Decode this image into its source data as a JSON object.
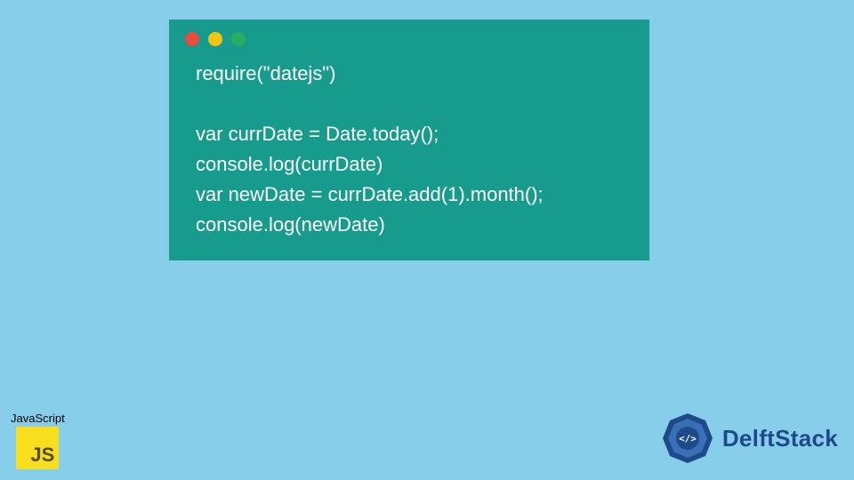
{
  "codeWindow": {
    "dots": [
      "red",
      "yellow",
      "green"
    ],
    "lines": [
      "require(\"datejs\")",
      "",
      "var currDate = Date.today();",
      "console.log(currDate)",
      "var newDate = currDate.add(1).month();",
      "console.log(newDate)"
    ]
  },
  "jsBadge": {
    "label": "JavaScript",
    "logoText": "JS"
  },
  "delft": {
    "brand": "DelftStack",
    "iconGlyph": "</>"
  },
  "colors": {
    "pageBg": "#87ceeb",
    "windowBg": "#179b8d",
    "codeText": "#ffffff",
    "dotRed": "#e74c3c",
    "dotYellow": "#f1c40f",
    "dotGreen": "#27ae60",
    "jsYellow": "#f7df1e",
    "delftBlue": "#1e4a8a"
  }
}
